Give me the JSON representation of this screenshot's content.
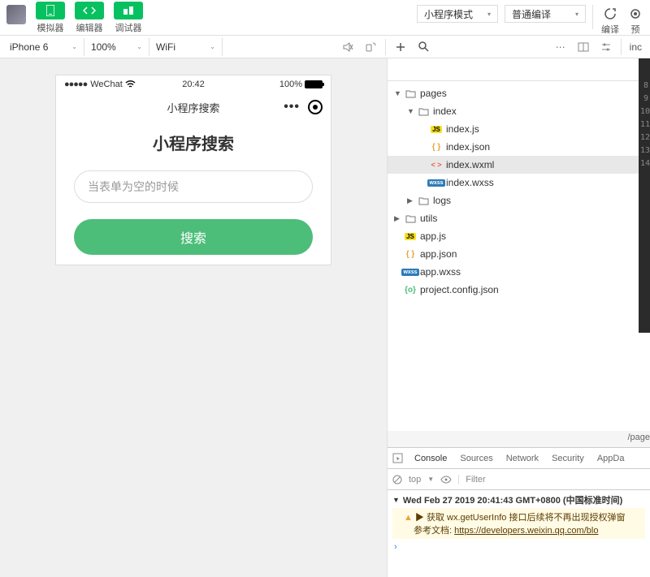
{
  "toolbar": {
    "simulator_label": "模拟器",
    "editor_label": "编辑器",
    "debugger_label": "调试器",
    "mode_select": "小程序模式",
    "compile_select": "普通编译",
    "compile_label": "编译",
    "preview_label": "预"
  },
  "secondbar": {
    "device": "iPhone 6",
    "zoom": "100%",
    "network": "WiFi",
    "editor_tab": "inc"
  },
  "simulator": {
    "carrier": "WeChat",
    "time": "20:42",
    "battery_pct": "100%",
    "nav_title": "小程序搜索",
    "page_title": "小程序搜索",
    "input_placeholder": "当表单为空的时候",
    "search_btn": "搜索"
  },
  "tree": {
    "items": [
      {
        "indent": 0,
        "chevron": "▼",
        "icon": "folder",
        "name": "pages"
      },
      {
        "indent": 1,
        "chevron": "▼",
        "icon": "folder",
        "name": "index"
      },
      {
        "indent": 2,
        "chevron": "",
        "icon": "js",
        "name": "index.js"
      },
      {
        "indent": 2,
        "chevron": "",
        "icon": "json",
        "name": "index.json"
      },
      {
        "indent": 2,
        "chevron": "",
        "icon": "wxml",
        "name": "index.wxml",
        "selected": true
      },
      {
        "indent": 2,
        "chevron": "",
        "icon": "wxss",
        "name": "index.wxss"
      },
      {
        "indent": 1,
        "chevron": "▶",
        "icon": "folder",
        "name": "logs"
      },
      {
        "indent": 0,
        "chevron": "▶",
        "icon": "folder",
        "name": "utils"
      },
      {
        "indent": 0,
        "chevron": "",
        "icon": "js",
        "name": "app.js"
      },
      {
        "indent": 0,
        "chevron": "",
        "icon": "json",
        "name": "app.json"
      },
      {
        "indent": 0,
        "chevron": "",
        "icon": "wxss",
        "name": "app.wxss"
      },
      {
        "indent": 0,
        "chevron": "",
        "icon": "config",
        "name": "project.config.json"
      }
    ]
  },
  "code": {
    "breadcrumb": "/page",
    "line_start": 8,
    "line_end": 14
  },
  "devtools": {
    "tabs": [
      "Console",
      "Sources",
      "Network",
      "Security",
      "AppDa"
    ],
    "active_tab": "Console",
    "filter_context": "top",
    "filter_placeholder": "Filter",
    "timestamp": "Wed Feb 27 2019 20:41:43 GMT+0800 (中国标准时间)",
    "warn_line1_prefix": "▶ 获取 ",
    "warn_line1_code": "wx.getUserInfo",
    "warn_line1_suffix": " 接口后续将不再出现授权弹窗",
    "warn_line2_prefix": "参考文档: ",
    "warn_line2_link": "https://developers.weixin.qq.com/blo"
  }
}
